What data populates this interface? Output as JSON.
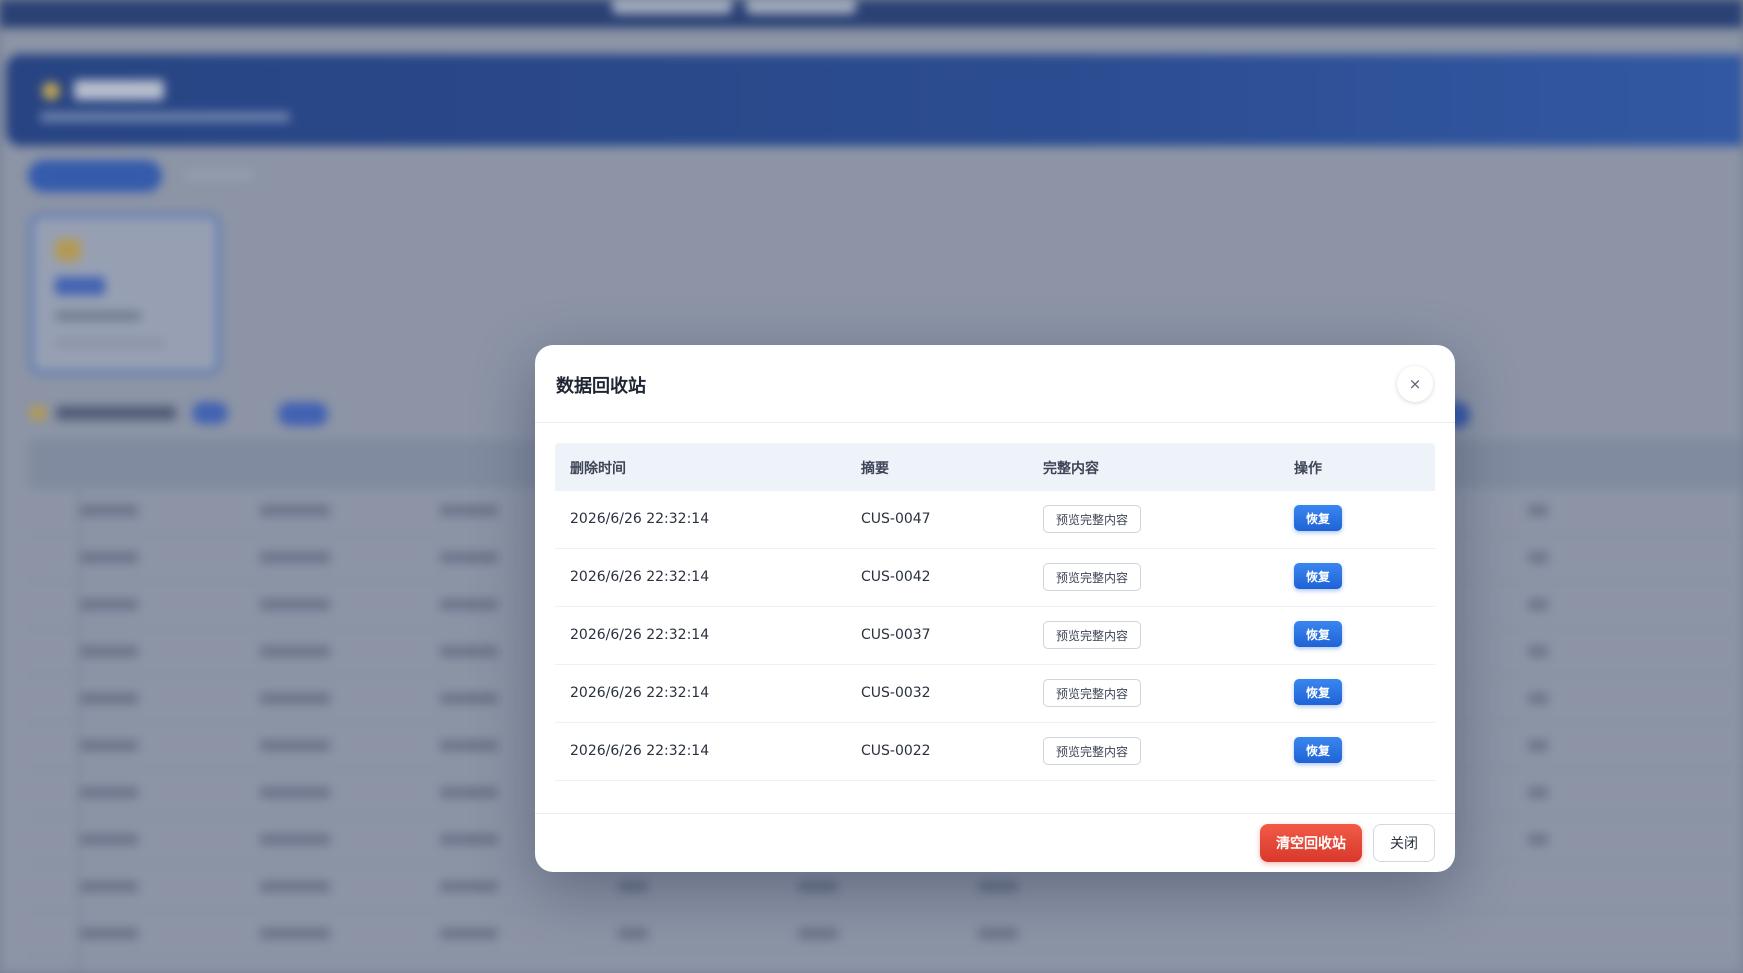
{
  "modal": {
    "title": "数据回收站",
    "close_icon": "×",
    "columns": [
      "删除时间",
      "摘要",
      "完整内容",
      "操作"
    ],
    "rows": [
      {
        "deleted_at": "2026/6/26 22:32:14",
        "summary": "CUS-0047",
        "preview_label": "预览完整内容",
        "restore_label": "恢复"
      },
      {
        "deleted_at": "2026/6/26 22:32:14",
        "summary": "CUS-0042",
        "preview_label": "预览完整内容",
        "restore_label": "恢复"
      },
      {
        "deleted_at": "2026/6/26 22:32:14",
        "summary": "CUS-0037",
        "preview_label": "预览完整内容",
        "restore_label": "恢复"
      },
      {
        "deleted_at": "2026/6/26 22:32:14",
        "summary": "CUS-0032",
        "preview_label": "预览完整内容",
        "restore_label": "恢复"
      },
      {
        "deleted_at": "2026/6/26 22:32:14",
        "summary": "CUS-0022",
        "preview_label": "预览完整内容",
        "restore_label": "恢复"
      }
    ],
    "footer": {
      "empty_label": "清空回收站",
      "close_label": "关闭"
    }
  },
  "colors": {
    "primary": "#1f63d6",
    "danger": "#d8382a",
    "banner": "#1a3e8c"
  }
}
